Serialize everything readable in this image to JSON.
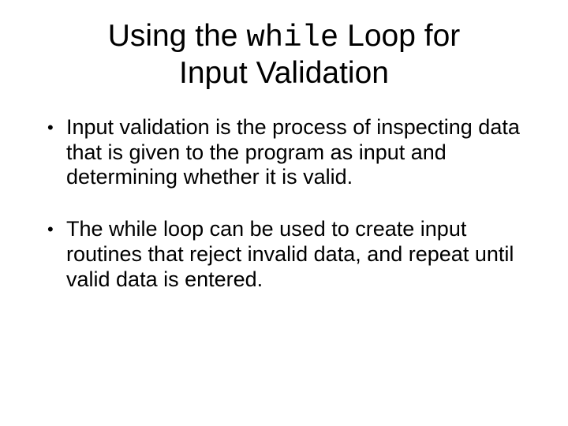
{
  "title": {
    "pre": "Using the ",
    "code": "while",
    "post": " Loop for",
    "line2": "Input Validation"
  },
  "bullets": [
    "Input validation is the process of inspecting data that is given to the program as input and determining whether it is valid.",
    "The while loop can be used to create input routines that reject invalid data, and repeat until valid data is entered."
  ]
}
